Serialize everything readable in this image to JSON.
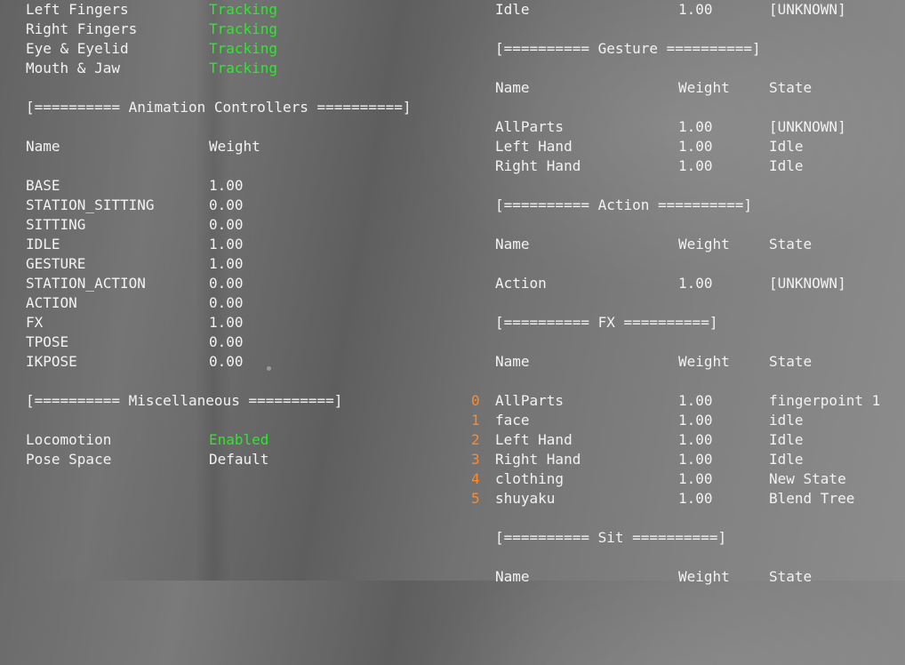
{
  "tracking": [
    {
      "label": "Left Fingers",
      "status": "Tracking"
    },
    {
      "label": "Right Fingers",
      "status": "Tracking"
    },
    {
      "label": "Eye & Eyelid",
      "status": "Tracking"
    },
    {
      "label": "Mouth & Jaw",
      "status": "Tracking"
    }
  ],
  "anim_controllers": {
    "header": "[========== Animation Controllers ==========]",
    "col_name": "Name",
    "col_weight": "Weight",
    "rows": [
      {
        "name": "BASE",
        "weight": "1.00"
      },
      {
        "name": "STATION_SITTING",
        "weight": "0.00"
      },
      {
        "name": "SITTING",
        "weight": "0.00"
      },
      {
        "name": "IDLE",
        "weight": "1.00"
      },
      {
        "name": "GESTURE",
        "weight": "1.00"
      },
      {
        "name": "STATION_ACTION",
        "weight": "0.00"
      },
      {
        "name": "ACTION",
        "weight": "0.00"
      },
      {
        "name": "FX",
        "weight": "1.00"
      },
      {
        "name": "TPOSE",
        "weight": "0.00"
      },
      {
        "name": "IKPOSE",
        "weight": "0.00"
      }
    ]
  },
  "misc": {
    "header": "[========== Miscellaneous ==========]",
    "rows": [
      {
        "name": "Locomotion",
        "value": "Enabled"
      },
      {
        "name": "Pose Space",
        "value": "Default"
      }
    ]
  },
  "idle_row": {
    "name": "Idle",
    "weight": "1.00",
    "state": "[UNKNOWN]"
  },
  "gesture": {
    "header": "[========== Gesture ==========]",
    "col_name": "Name",
    "col_weight": "Weight",
    "col_state": "State",
    "rows": [
      {
        "name": "AllParts",
        "weight": "1.00",
        "state": "[UNKNOWN]"
      },
      {
        "name": "Left Hand",
        "weight": "1.00",
        "state": "Idle"
      },
      {
        "name": "Right Hand",
        "weight": "1.00",
        "state": "Idle"
      }
    ]
  },
  "action": {
    "header": "[========== Action ==========]",
    "col_name": "Name",
    "col_weight": "Weight",
    "col_state": "State",
    "rows": [
      {
        "name": "Action",
        "weight": "1.00",
        "state": "[UNKNOWN]"
      }
    ]
  },
  "fx": {
    "header": "[========== FX ==========]",
    "col_name": "Name",
    "col_weight": "Weight",
    "col_state": "State",
    "rows": [
      {
        "index": "0",
        "name": "AllParts",
        "weight": "1.00",
        "state": "fingerpoint 1"
      },
      {
        "index": "1",
        "name": "face",
        "weight": "1.00",
        "state": "idle"
      },
      {
        "index": "2",
        "name": "Left Hand",
        "weight": "1.00",
        "state": "Idle"
      },
      {
        "index": "3",
        "name": "Right Hand",
        "weight": "1.00",
        "state": "Idle"
      },
      {
        "index": "4",
        "name": "clothing",
        "weight": "1.00",
        "state": "New State"
      },
      {
        "index": "5",
        "name": "shuyaku",
        "weight": "1.00",
        "state": "Blend Tree"
      }
    ]
  },
  "sit": {
    "header": "[========== Sit ==========]",
    "col_name": "Name",
    "col_weight": "Weight",
    "col_state": "State"
  }
}
